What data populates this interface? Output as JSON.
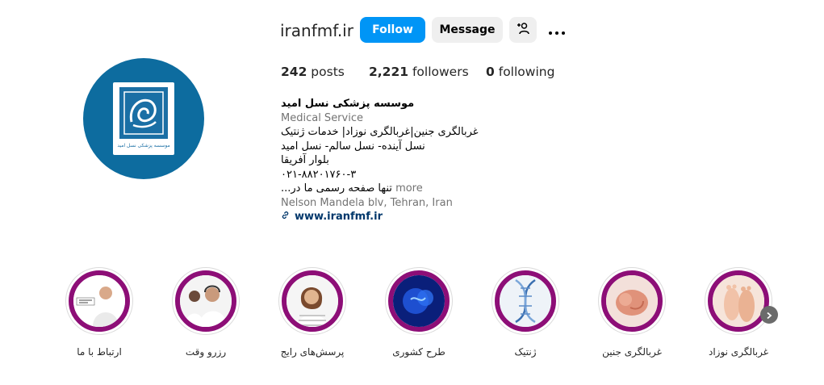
{
  "profile": {
    "username": "iranfmf.ir",
    "follow_label": "Follow",
    "message_label": "Message",
    "suggest_icon": "person-add-icon",
    "more_icon": "ellipsis-icon",
    "logo_caption": "موسسه پزشکی نسل امید"
  },
  "stats": {
    "posts_count": "242",
    "posts_label": "posts",
    "followers_count": "2,221",
    "followers_label": "followers",
    "following_count": "0",
    "following_label": "following"
  },
  "bio": {
    "name": "موسسه پزشکی نسل امید",
    "category": "Medical Service",
    "line1": "غربالگری جنین|غربالگری نوزاد| خدمات ژنتیک",
    "line2": "نسل آینده- نسل سالم- نسل امید",
    "line3": "بلوار آفریقا",
    "line4": "۰۲۱-۸۸۲۰۱۷۶۰-۳",
    "line5": "...تنها صفحه رسمی ما در",
    "more_label": "more",
    "address": "Nelson Mandela blv, Tehran, Iran",
    "website": "www.iranfmf.ir"
  },
  "highlights": [
    {
      "label": "ارتباط با ما",
      "icon": "contact-us-icon"
    },
    {
      "label": "رزرو وقت",
      "icon": "headset-agents-icon"
    },
    {
      "label": "پرسش‌های رایج",
      "icon": "thinking-woman-icon"
    },
    {
      "label": "طرح کشوری",
      "icon": "cells-icon"
    },
    {
      "label": "ژنتیک",
      "icon": "dna-icon"
    },
    {
      "label": "غربالگری جنین",
      "icon": "fetus-icon"
    },
    {
      "label": "غربالگری نوزاد",
      "icon": "baby-feet-icon"
    }
  ],
  "colors": {
    "follow_blue": "#0095f6",
    "highlight_ring": "#8d0e77",
    "avatar_bg": "#0d6c9f"
  }
}
